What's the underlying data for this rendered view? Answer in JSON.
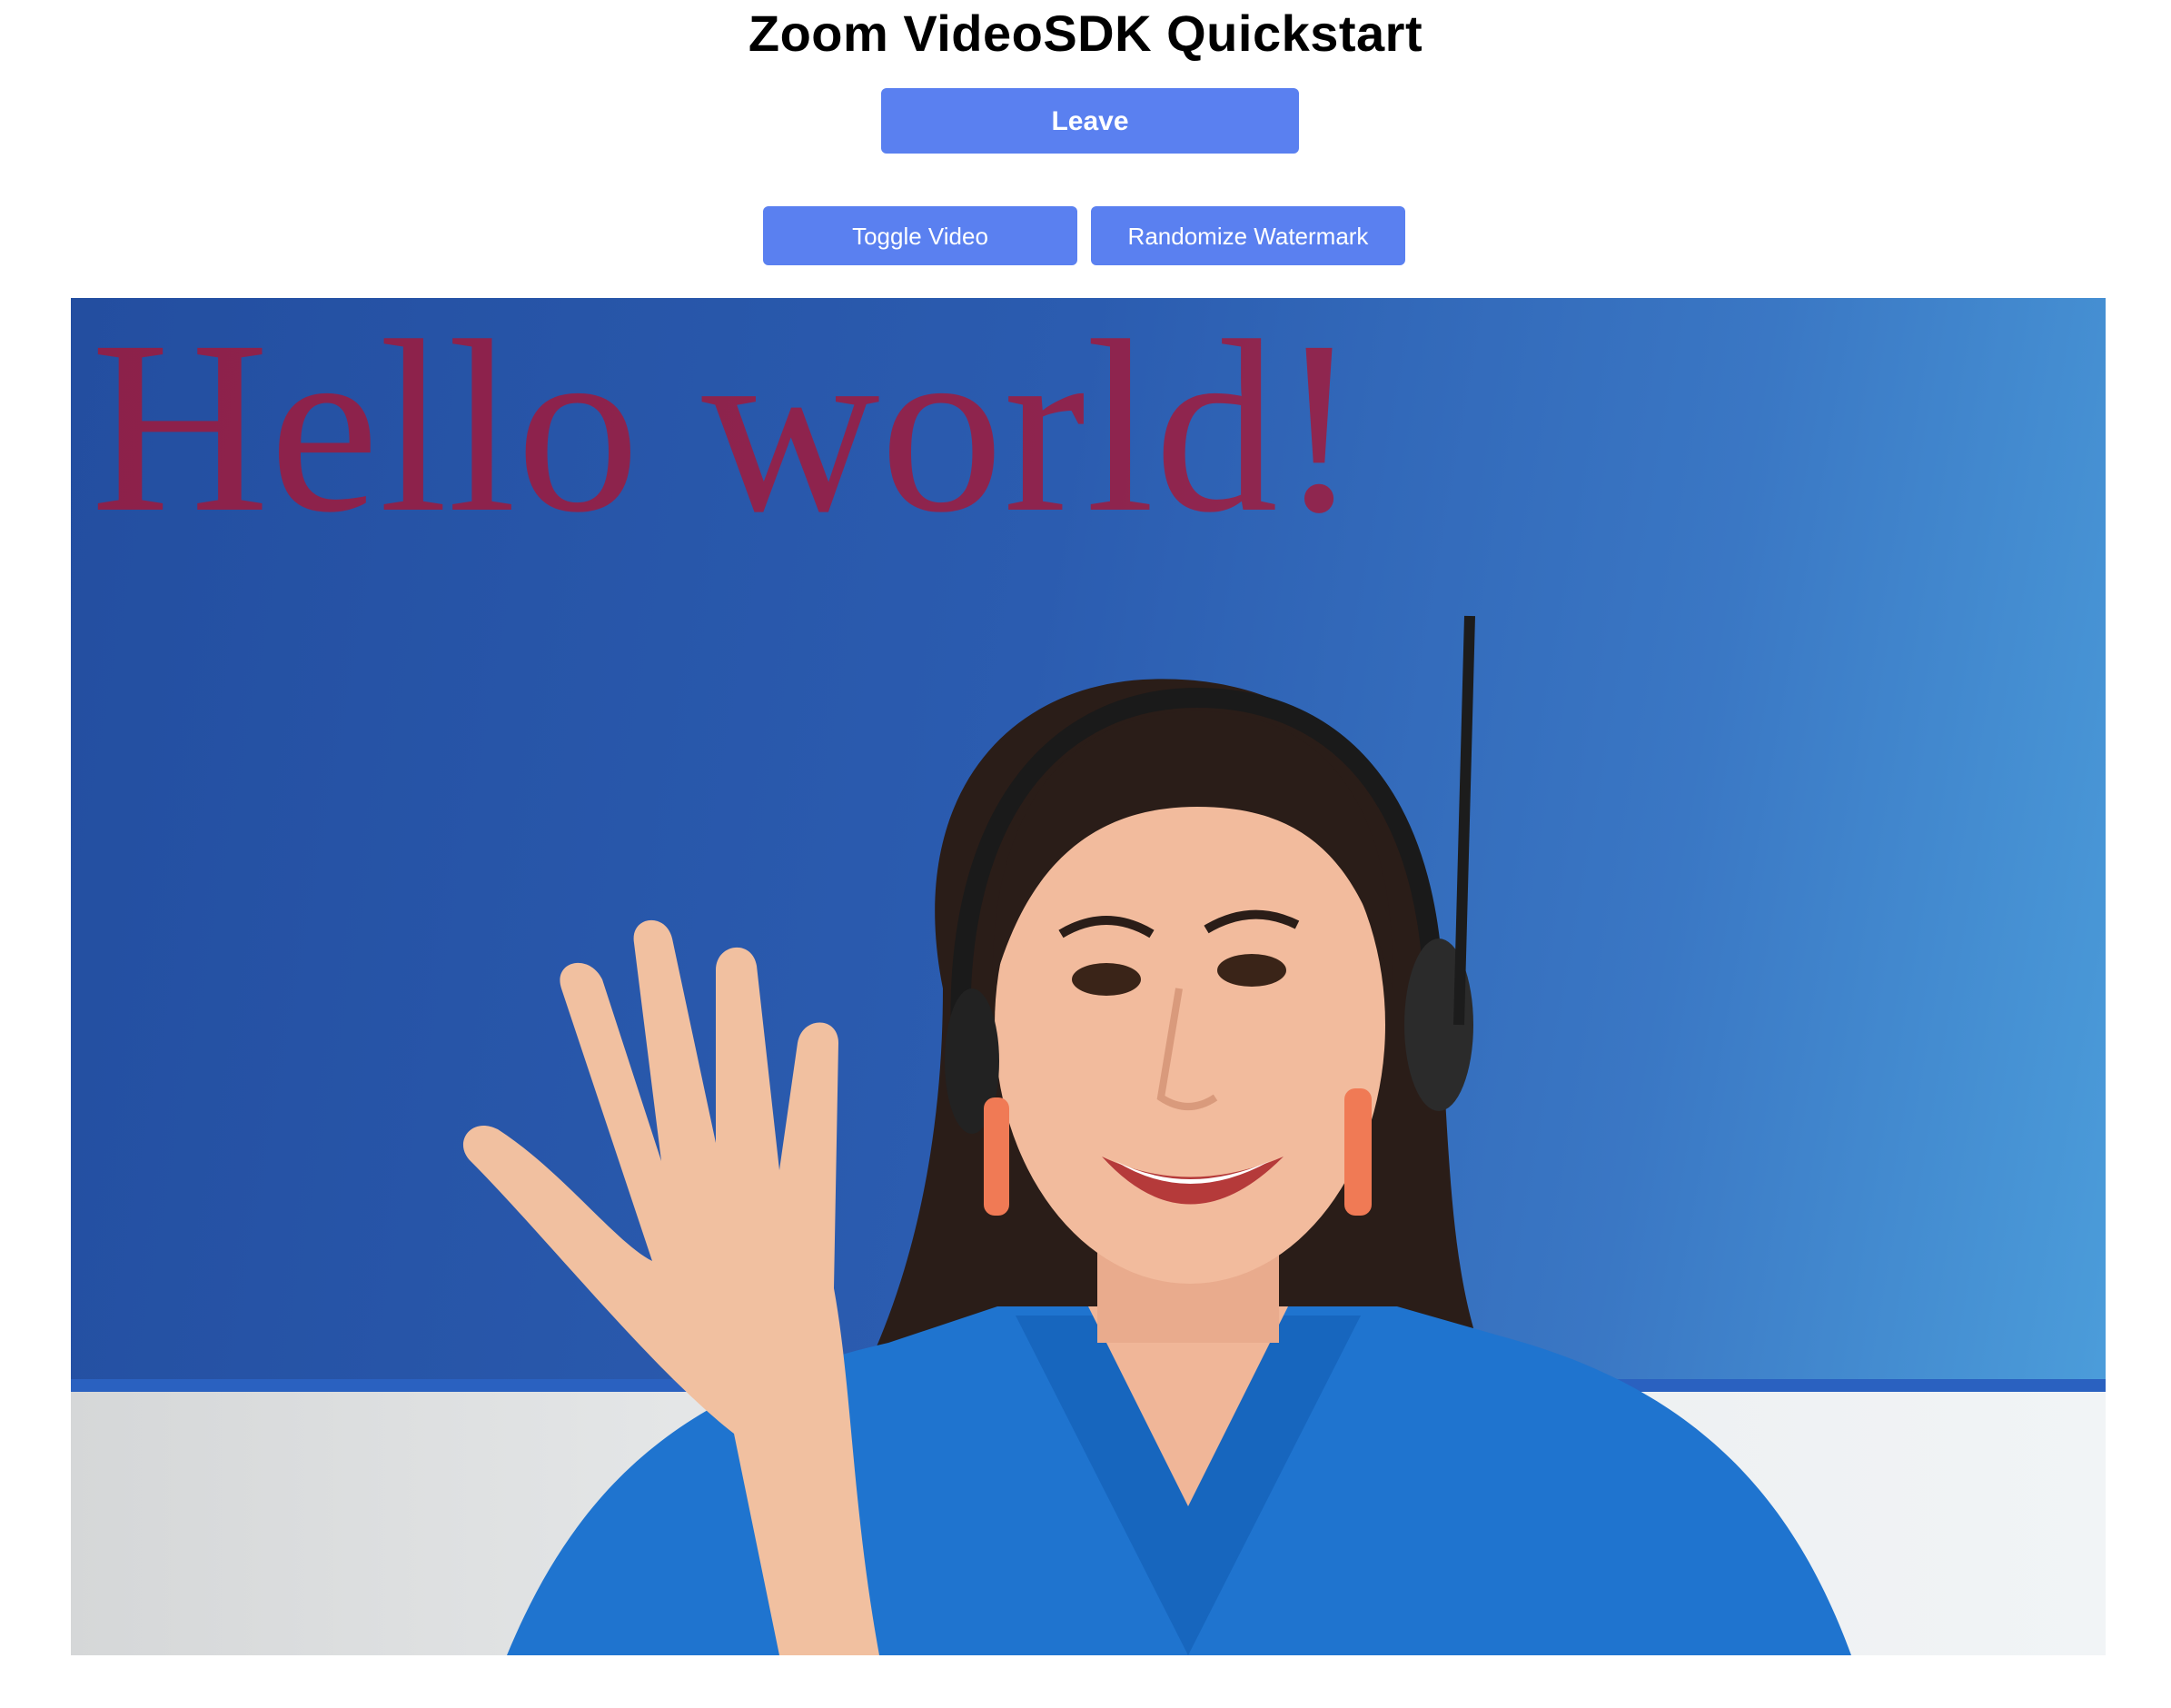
{
  "header": {
    "title": "Zoom VideoSDK Quickstart"
  },
  "controls": {
    "leave_label": "Leave",
    "toggle_video_label": "Toggle Video",
    "randomize_watermark_label": "Randomize Watermark"
  },
  "video": {
    "watermark_text": "Hello world!",
    "watermark_color": "#aa1432"
  },
  "colors": {
    "accent": "#5a80f0",
    "background": "#ffffff",
    "text": "#000000"
  }
}
